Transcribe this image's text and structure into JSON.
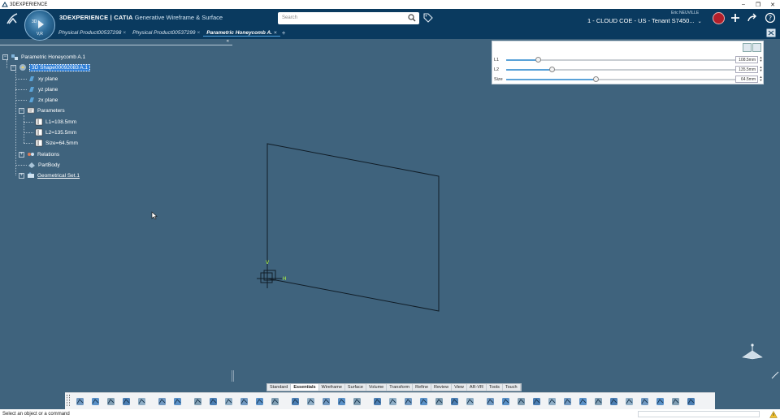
{
  "window": {
    "title": "3DEXPERIENCE",
    "controls": [
      "–",
      "❐",
      "✕"
    ]
  },
  "brand": {
    "prefix": "3D",
    "experience": "EXPERIENCE | CATIA",
    "app": "Generative Wireframe & Surface",
    "compass_labels": [
      "3D",
      "V,R"
    ]
  },
  "search": {
    "placeholder": "Search"
  },
  "user": {
    "name": "Eric NEUVILLE",
    "tenant": "1 - CLOUD COE - US - Tenant S7450..."
  },
  "tabs": [
    {
      "label": "Physical Product00537298",
      "active": false
    },
    {
      "label": "Physical Product00537299",
      "active": false
    },
    {
      "label": "Parametric Honeycomb A.",
      "active": true
    }
  ],
  "tree": {
    "root": "Parametric Honeycomb A.1",
    "shape": "3D Shape00092083 A.1",
    "planes": [
      "xy plane",
      "yz plane",
      "zx plane"
    ],
    "parameters_label": "Parameters",
    "parameters": [
      "L1=108.5mm",
      "L2=135.5mm",
      "Size=64.5mm"
    ],
    "relations": "Relations",
    "partbody": "PartBody",
    "geoset": "Geometrical Set.1"
  },
  "parameter_panel": {
    "rows": [
      {
        "label": "L1",
        "value": "108.5mm",
        "fraction": 0.14
      },
      {
        "label": "L2",
        "value": "135.5mm",
        "fraction": 0.2
      },
      {
        "label": "Size",
        "value": "64.5mm",
        "fraction": 0.39
      }
    ]
  },
  "axis_labels": {
    "v": "V",
    "h": "H"
  },
  "section_tabs": [
    "Standard",
    "Essentials",
    "Wireframe",
    "Surface",
    "Volume",
    "Transform",
    "Refine",
    "Review",
    "View",
    "AR-VR",
    "Tools",
    "Touch"
  ],
  "active_section": "Essentials",
  "status": {
    "prompt": "Select an object or a command"
  },
  "colors": {
    "viewport": "#3f637d",
    "topband": "#0a3a5f",
    "selection": "#2f7fd6",
    "accent": "#5aa2d8"
  }
}
